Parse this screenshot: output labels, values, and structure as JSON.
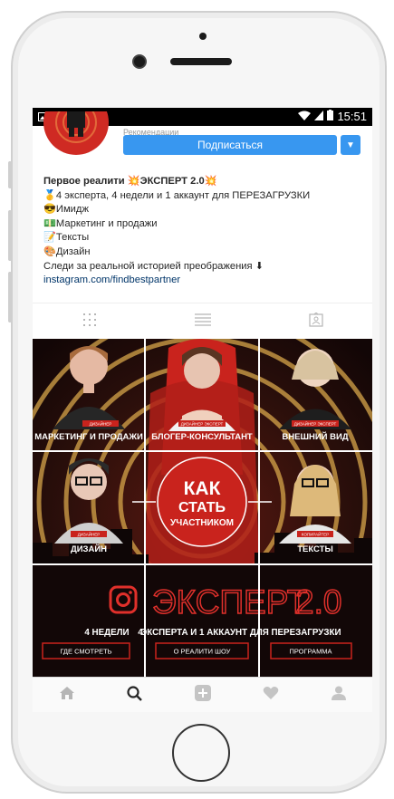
{
  "status_bar": {
    "time": "15:51"
  },
  "profile": {
    "follow_label": "Подписаться",
    "header_hint": "Рекомендации",
    "bio_title": "Первое реалити 💥ЭКСПЕРТ 2.0💥",
    "bio_lines": [
      "🥇4 эксперта, 4 недели и 1 аккаунт для ПЕРЕЗАГРУЗКИ",
      "😎Имидж",
      "💵Маркетинг и продажи",
      "📝Тексты",
      "🎨Дизайн",
      "Следи за реальной историей преображения ⬇"
    ],
    "link": "instagram.com/findbestpartner"
  },
  "post_grid": {
    "tiles": [
      {
        "role": "ДИЗАЙНЕР",
        "label": "МАРКЕТИНГ И ПРОДАЖИ"
      },
      {
        "role": "ДИЗАЙНЕР ЭКСПЕРТ",
        "label": "БЛОГЕР-КОНСУЛЬТАНТ"
      },
      {
        "role": "ДИЗАЙНЕР ЭКСПЕРТ",
        "label": "ВНЕШНИЙ ВИД"
      },
      {
        "role": "ДИЗАЙНЕР",
        "label": "ДИЗАЙН"
      },
      {
        "role": "",
        "label": ""
      },
      {
        "role": "КОПИРАЙТЕР",
        "label": "ТЕКСТЫ"
      }
    ],
    "center_title_1": "КАК",
    "center_title_2": "СТАТЬ",
    "center_title_3": "УЧАСТНИКОМ",
    "banner_title": "ЭКСПЕРТ",
    "banner_version": "2.0",
    "banner_subtitle_parts": [
      "4 НЕДЕЛИ",
      "4",
      "ЭКСПЕРТА И 1 АККАУНТ ДЛЯ",
      "ПЕРЕЗАГРУЗКИ"
    ],
    "buttons": [
      "ГДЕ СМОТРЕТЬ",
      "О РЕАЛИТИ ШОУ",
      "ПРОГРАММА"
    ]
  },
  "bottom_nav": [
    "home-icon",
    "search-icon",
    "add-icon",
    "heart-icon",
    "profile-icon"
  ],
  "colors": {
    "accent": "#3897f0",
    "brand_red": "#cf2a23",
    "dark": "#1d0d0d",
    "gold": "#d6a54a"
  }
}
